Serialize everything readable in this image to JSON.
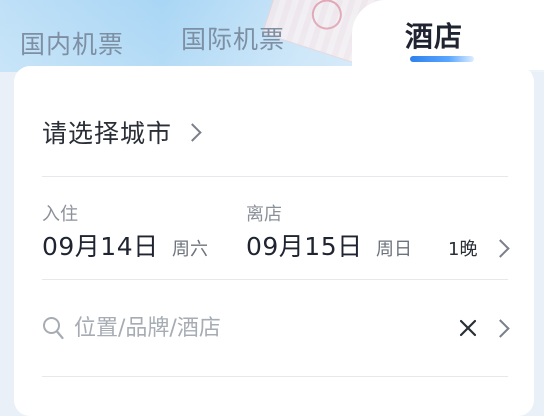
{
  "tabs": [
    {
      "label": "国内机票",
      "active": false
    },
    {
      "label": "国际机票",
      "active": false
    },
    {
      "label": "酒店",
      "active": true
    }
  ],
  "city": {
    "label": "请选择城市"
  },
  "stay": {
    "checkin_label": "入住",
    "checkin_date": "09月14日",
    "checkin_weekday": "周六",
    "checkout_label": "离店",
    "checkout_date": "09月15日",
    "checkout_weekday": "周日",
    "nights": "1晚"
  },
  "search": {
    "placeholder": "位置/品牌/酒店",
    "value": ""
  },
  "colors": {
    "accent": "#2f80ed",
    "text_primary": "#1f2430",
    "text_muted": "#8b9099"
  },
  "icons": [
    "search-icon",
    "close-icon",
    "chevron-right-icon"
  ]
}
